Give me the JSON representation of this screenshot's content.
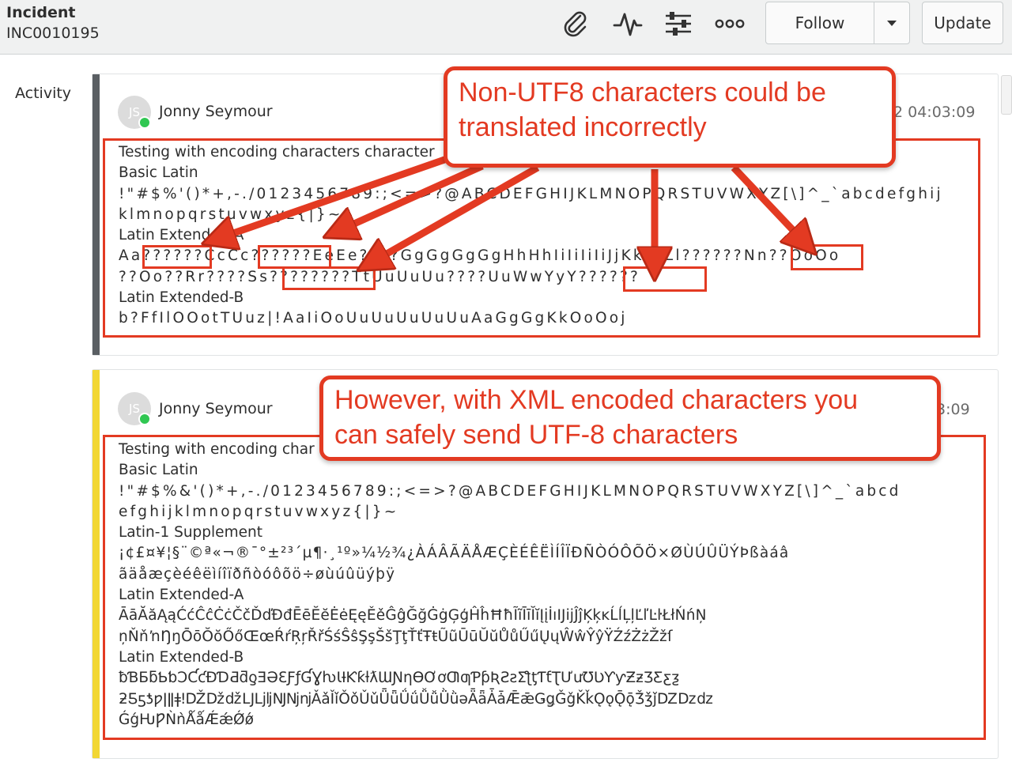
{
  "header": {
    "title": "Incident",
    "number": "INC0010195",
    "icons": [
      "paperclip-icon",
      "activity-pulse-icon",
      "sliders-icon",
      "more-dots-icon"
    ],
    "follow_label": "Follow",
    "update_label": "Update"
  },
  "activity_label": "Activity",
  "entries": [
    {
      "avatar_initials": "JS",
      "author": "Jonny Seymour",
      "timestamp": "2 04:03:09",
      "bar_color": "#5a5f63",
      "lines": [
        "Testing with encoding characters character",
        "Basic Latin",
        "!\"#$%'()*+,-./0123456789:;<=>?@ABCDEFGHIJKLMNOPQRSTUVWXYZ[\\]^_`abcdefghij",
        "klmnopqrstuvwxyz{|}~",
        "Latin Extended-A",
        "Aa??????CcCc??????EeEe????GgGgGgGgHhHhIiIiIiIiJjKk??Ll??????Nn??OoOo",
        "??Oo??Rr????Ss????????TtUuUuUu????UuWwYyY??????",
        "Latin Extended-B",
        "b?FfIlOOotTUuz|!AaIiOoUuUuUuUuUuAaGgGgKkOoOoj"
      ]
    },
    {
      "avatar_initials": "JS",
      "author": "Jonny Seymour",
      "timestamp": "3:09",
      "bar_color": "#f2d733",
      "lines": [
        "Testing with encoding char",
        "Basic Latin",
        "!\"#$%&'()*+,-./0123456789:;<=>?@ABCDEFGHIJKLMNOPQRSTUVWXYZ[\\]^_`abcd",
        "efghijklmnopqrstuvwxyz{|}~",
        "Latin-1 Supplement",
        "¡¢£¤¥¦§¨©ª«¬®¯°±²³´µ¶·¸¹º»¼½¾¿ÀÁÂÃÄÅÆÇÈÉÊËÌÍÎÏÐÑÒÓÔÕÖ×ØÙÚÛÜÝÞßàáâ",
        "ãäåæçèéêëìíîïðñòóôõö÷øùúûüýþÿ",
        "Latin Extended-A",
        "ĀāĂăĄąĆćĈĉĊċČčĎďĐđĒēĔĕĖėĘęĚěĜĝĞğĠġĢģĤĥĦħĨĩĪīĬĭĮįİıĲĳĴĵĶķĸĹĺĻļĽľĿŀŁłŃńŅ",
        "ņŇňŉŊŋŌōŎŏŐőŒœŔŕŖŗŘřŚśŜŝŞşŠšŢţŤťŦŧŨũŪūŬŭŮůŰűŲųŴŵŶŷŸŹźŻżŽžſ",
        "Latin Extended-B",
        "ƀƁƂƃƄƅƆƇƈƉƊƋƌƍƎƏƐƑƒƓƔƕƖƗƘƙƚƛƜƝƞƟƠơƢƣƤƥƦƧƨƩƪƫƬƭƮƯưƱƲƳƴƵƶƷƸƹƺ",
        "ƻƼƽƾƿǀǁǂǃǄǅǆǇǈǉǊǋǌǍǎǏǐǑǒǓǔǕǖǗǘǙǚǛǜǝǞǟǠǡǢǣǤǥǦǧǨǩǪǫǬǭǮǯǰǱǲǳ",
        "ǴǵǶǷǸǹǺǻǼǽǾǿ"
      ]
    }
  ],
  "callouts": [
    {
      "line1": "Non-UTF8 characters could be",
      "line2": "translated incorrectly"
    },
    {
      "line1": "However, with XML encoded characters you",
      "line2": "can safely send UTF-8 characters"
    }
  ],
  "annotation_color": "#e33a22"
}
